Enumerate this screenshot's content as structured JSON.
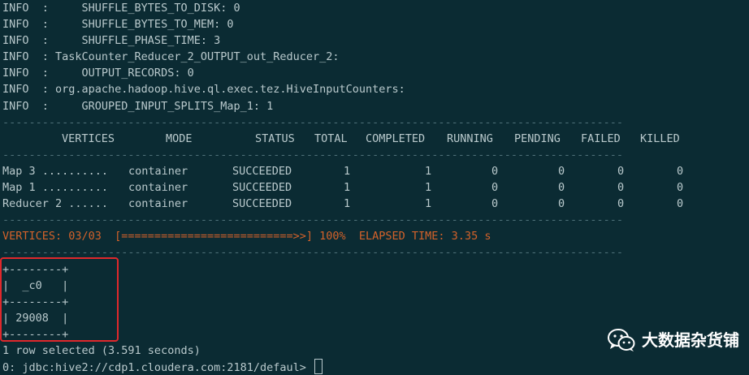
{
  "log_lines": [
    "INFO  :     SHUFFLE_BYTES_TO_DISK: 0",
    "INFO  :     SHUFFLE_BYTES_TO_MEM: 0",
    "INFO  :     SHUFFLE_PHASE_TIME: 3",
    "INFO  : TaskCounter_Reducer_2_OUTPUT_out_Reducer_2:",
    "INFO  :     OUTPUT_RECORDS: 0",
    "INFO  : org.apache.hadoop.hive.ql.exec.tez.HiveInputCounters:",
    "INFO  :     GROUPED_INPUT_SPLITS_Map_1: 1"
  ],
  "separator": "----------------------------------------------------------------------------------------------",
  "table_headers": [
    "VERTICES",
    "MODE",
    "STATUS",
    "TOTAL",
    "COMPLETED",
    "RUNNING",
    "PENDING",
    "FAILED",
    "KILLED"
  ],
  "rows": [
    {
      "vertex": "Map 3 ..........",
      "mode": "container",
      "status": "SUCCEEDED",
      "total": "1",
      "completed": "1",
      "running": "0",
      "pending": "0",
      "failed": "0",
      "killed": "0"
    },
    {
      "vertex": "Map 1 ..........",
      "mode": "container",
      "status": "SUCCEEDED",
      "total": "1",
      "completed": "1",
      "running": "0",
      "pending": "0",
      "failed": "0",
      "killed": "0"
    },
    {
      "vertex": "Reducer 2 ......",
      "mode": "container",
      "status": "SUCCEEDED",
      "total": "1",
      "completed": "1",
      "running": "0",
      "pending": "0",
      "failed": "0",
      "killed": "0"
    }
  ],
  "progress_line": "VERTICES: 03/03  [==========================>>] 100%  ELAPSED TIME: 3.35 s",
  "result_table": {
    "border": "+--------+",
    "header_row": "|  _c0   |",
    "value_row": "| 29008  |"
  },
  "rows_selected": "1 row selected (3.591 seconds)",
  "prompt": "0: jdbc:hive2://cdp1.cloudera.com:2181/defaul>",
  "watermark": {
    "text": "大数据杂货铺",
    "icon": "wechat-icon"
  },
  "colors": {
    "background": "#0b2b33",
    "text": "#b9c9cc",
    "progress": "#d4622a",
    "highlight": "#e0282c"
  }
}
